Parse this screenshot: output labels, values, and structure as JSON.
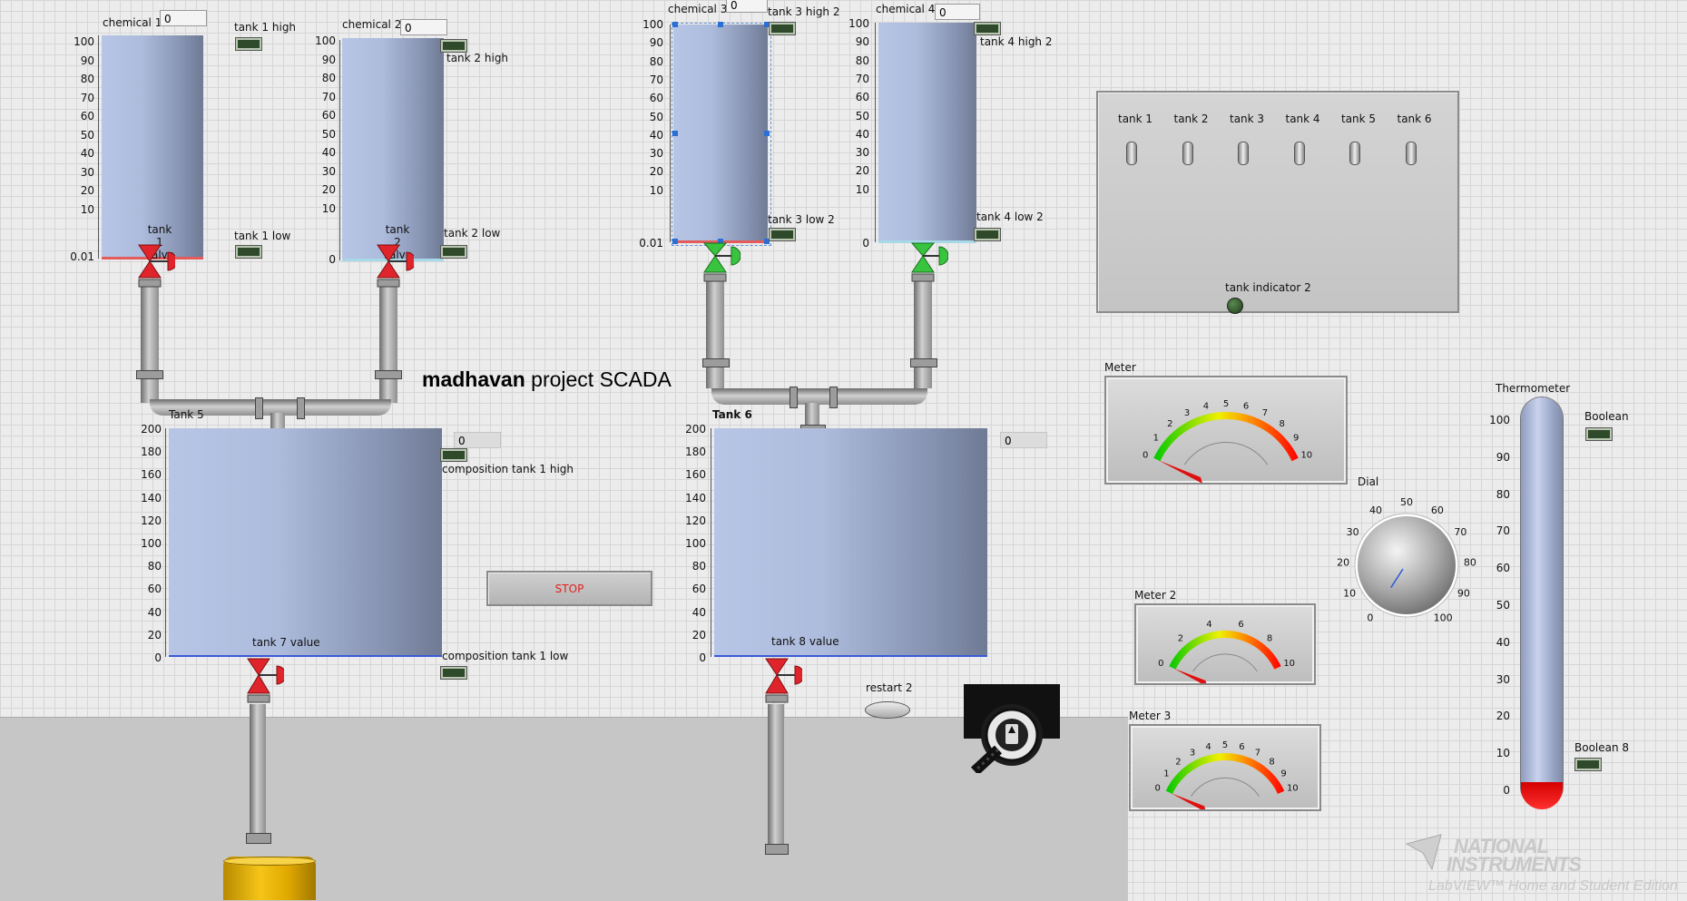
{
  "title": {
    "bold": "madhavan",
    "rest": " project SCADA"
  },
  "scales": {
    "s100": [
      "100",
      "90",
      "80",
      "70",
      "60",
      "50",
      "40",
      "30",
      "20",
      "10"
    ],
    "s200": [
      "200",
      "180",
      "160",
      "140",
      "120",
      "100",
      "80",
      "60",
      "40",
      "20",
      "0"
    ],
    "bottom_t1": "0.01",
    "bottom_t2": "0",
    "bottom_t3": "0.01",
    "bottom_t4": "0"
  },
  "tanks": {
    "chem1_label": "chemical 1",
    "chem1_value": "0",
    "chem2_label": "chemical 2",
    "chem2_value": "0",
    "chem3_label": "chemical 3",
    "chem3_value": "0",
    "chem4_label": "chemical 4",
    "chem4_value": "0",
    "t1_high": "tank 1 high",
    "t1_low": "tank 1 low",
    "t1_valve": "tank 1 valve",
    "t2_high": "tank 2 high",
    "t2_low": "tank 2 low",
    "t2_valve": "tank 2 valve",
    "t3_high": "tank 3 high 2",
    "t3_low": "tank 3 low 2",
    "t4_high": "tank 4 high 2",
    "t4_low": "tank 4 low 2",
    "t5_label": "Tank 5",
    "t6_label": "Tank 6",
    "t5_value": "0",
    "t6_value": "0",
    "t7_valve": "tank 7  value",
    "t8_valve": "tank 8  value",
    "comp_high": "composition tank 1 high",
    "comp_low": "composition tank 1 low"
  },
  "controls": {
    "stop": "STOP",
    "restart": "restart 2",
    "tank_indicator": "tank  indicator 2",
    "toggles": [
      "tank 1",
      "tank 2",
      "tank 3",
      "tank 4",
      "tank 5",
      "tank 6"
    ]
  },
  "meters": {
    "meter1": {
      "label": "Meter",
      "ticks": [
        "0",
        "1",
        "2",
        "3",
        "4",
        "5",
        "6",
        "7",
        "8",
        "9",
        "10"
      ]
    },
    "meter2": {
      "label": "Meter 2",
      "ticks": [
        "0",
        "2",
        "4",
        "6",
        "8",
        "10"
      ]
    },
    "meter3": {
      "label": "Meter 3",
      "ticks": [
        "0",
        "1",
        "2",
        "3",
        "4",
        "5",
        "6",
        "7",
        "8",
        "9",
        "10"
      ]
    }
  },
  "dial": {
    "label": "Dial",
    "ticks": [
      "0",
      "10",
      "20",
      "30",
      "40",
      "50",
      "60",
      "70",
      "80",
      "90",
      "100"
    ]
  },
  "thermometer": {
    "label": "Thermometer",
    "ticks": [
      "100",
      "90",
      "80",
      "70",
      "60",
      "50",
      "40",
      "30",
      "20",
      "10",
      "0"
    ]
  },
  "booleans": {
    "b1": "Boolean",
    "b8": "Boolean 8"
  },
  "watermark": {
    "line1": "NATIONAL",
    "line2": "INSTRUMENTS",
    "line3": "LabVIEW™ Home and Student Edition"
  },
  "colors": {
    "tank_fill": "#b7c5e6",
    "valve_red": "#e0242c",
    "valve_green": "#38c43e",
    "led_dark": "#2f4a2a"
  }
}
